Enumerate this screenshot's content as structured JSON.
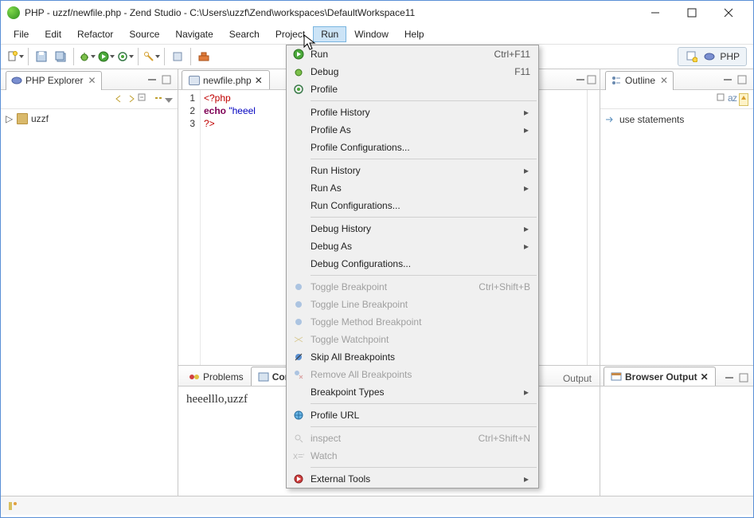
{
  "window": {
    "title": "PHP - uzzf/newfile.php - Zend Studio - C:\\Users\\uzzf\\Zend\\workspaces\\DefaultWorkspace11"
  },
  "menu": {
    "file": "File",
    "edit": "Edit",
    "refactor": "Refactor",
    "source": "Source",
    "navigate": "Navigate",
    "search": "Search",
    "project": "Project",
    "run": "Run",
    "window": "Window",
    "help": "Help"
  },
  "perspective": {
    "label": "PHP"
  },
  "explorer": {
    "title": "PHP Explorer",
    "project": "uzzf"
  },
  "editor": {
    "tab": "newfile.php",
    "lines": [
      "<?php",
      "echo \"heeel",
      "?>"
    ],
    "line_nums": [
      "1",
      "2",
      "3"
    ]
  },
  "bottom": {
    "problems": "Problems",
    "console": "Con",
    "output": "Output",
    "browser": "Browser Output",
    "text": "heeelllo,uzzf"
  },
  "outline": {
    "title": "Outline",
    "item": "use statements"
  },
  "runmenu": {
    "run": {
      "label": "Run",
      "accel": "Ctrl+F11"
    },
    "debug": {
      "label": "Debug",
      "accel": "F11"
    },
    "profile": {
      "label": "Profile"
    },
    "profile_history": {
      "label": "Profile History"
    },
    "profile_as": {
      "label": "Profile As"
    },
    "profile_conf": {
      "label": "Profile Configurations..."
    },
    "run_history": {
      "label": "Run History"
    },
    "run_as": {
      "label": "Run As"
    },
    "run_conf": {
      "label": "Run Configurations..."
    },
    "debug_history": {
      "label": "Debug History"
    },
    "debug_as": {
      "label": "Debug As"
    },
    "debug_conf": {
      "label": "Debug Configurations..."
    },
    "toggle_bp": {
      "label": "Toggle Breakpoint",
      "accel": "Ctrl+Shift+B"
    },
    "toggle_line_bp": {
      "label": "Toggle Line Breakpoint"
    },
    "toggle_method_bp": {
      "label": "Toggle Method Breakpoint"
    },
    "toggle_watch": {
      "label": "Toggle Watchpoint"
    },
    "skip_all": {
      "label": "Skip All Breakpoints"
    },
    "remove_all": {
      "label": "Remove All Breakpoints"
    },
    "bp_types": {
      "label": "Breakpoint Types"
    },
    "profile_url": {
      "label": "Profile URL"
    },
    "inspect": {
      "label": "inspect",
      "accel": "Ctrl+Shift+N"
    },
    "watch": {
      "label": "Watch"
    },
    "ext_tools": {
      "label": "External Tools"
    }
  }
}
